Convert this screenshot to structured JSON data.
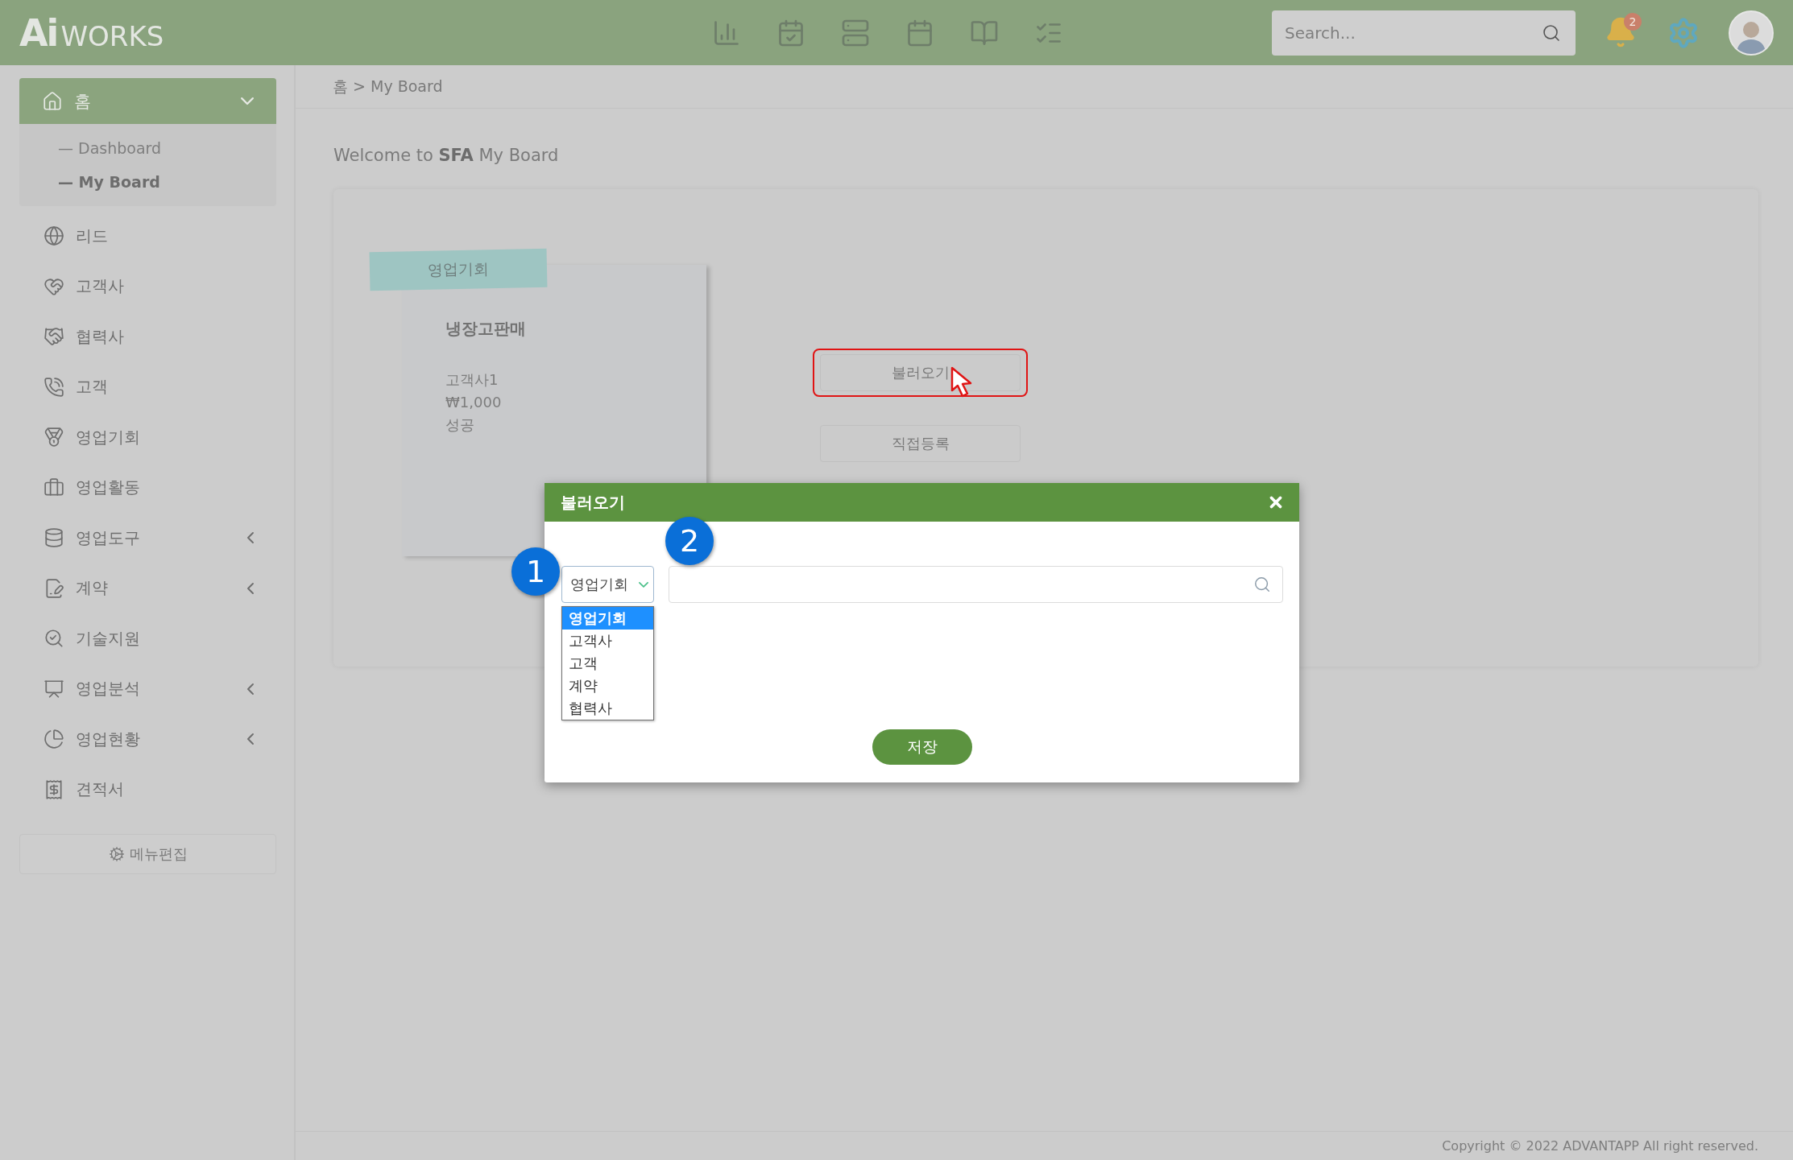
{
  "header": {
    "logo": {
      "mark": "Ai",
      "word": "WORKS"
    },
    "search": {
      "placeholder": "Search..."
    },
    "notifications": {
      "count": "2"
    }
  },
  "sidebar": {
    "items": [
      {
        "label": "홈",
        "kind": "submenu",
        "expanded": true,
        "children": [
          {
            "label": "— Dashboard",
            "selected": false
          },
          {
            "label": "— My Board",
            "selected": true
          }
        ]
      },
      {
        "label": "리드",
        "kind": "link"
      },
      {
        "label": "고객사",
        "kind": "link"
      },
      {
        "label": "협력사",
        "kind": "link"
      },
      {
        "label": "고객",
        "kind": "link"
      },
      {
        "label": "영업기회",
        "kind": "link"
      },
      {
        "label": "영업활동",
        "kind": "link"
      },
      {
        "label": "영업도구",
        "kind": "submenu",
        "expanded": false
      },
      {
        "label": "계약",
        "kind": "submenu",
        "expanded": false
      },
      {
        "label": "기술지원",
        "kind": "link"
      },
      {
        "label": "영업분석",
        "kind": "submenu",
        "expanded": false
      },
      {
        "label": "영업현황",
        "kind": "submenu",
        "expanded": false
      },
      {
        "label": "견적서",
        "kind": "link"
      }
    ],
    "menu_edit": "메뉴편집"
  },
  "breadcrumb": "홈 > My Board",
  "welcome": "Welcome to **SFA** My Board",
  "board": {
    "card": {
      "tag": "영업기회",
      "title": "냉장고판매",
      "lines": [
        "고객사1",
        "₩1,000",
        "성공"
      ]
    },
    "buttons": [
      {
        "label": "불러오기",
        "highlighted": true
      },
      {
        "label": "직접등록",
        "highlighted": false
      }
    ]
  },
  "modal": {
    "title": "불러오기",
    "select": {
      "value": "영업기회",
      "expanded": true,
      "options": [
        {
          "label": "영업기회",
          "selected": true
        },
        {
          "label": "고객사",
          "selected": false
        },
        {
          "label": "고객",
          "selected": false
        },
        {
          "label": "계약",
          "selected": false
        },
        {
          "label": "협력사",
          "selected": false
        }
      ]
    },
    "save": "저장",
    "markers": [
      "1",
      "2"
    ]
  },
  "footer": "Copyright © 2022 ADVANTAPP All right reserved."
}
